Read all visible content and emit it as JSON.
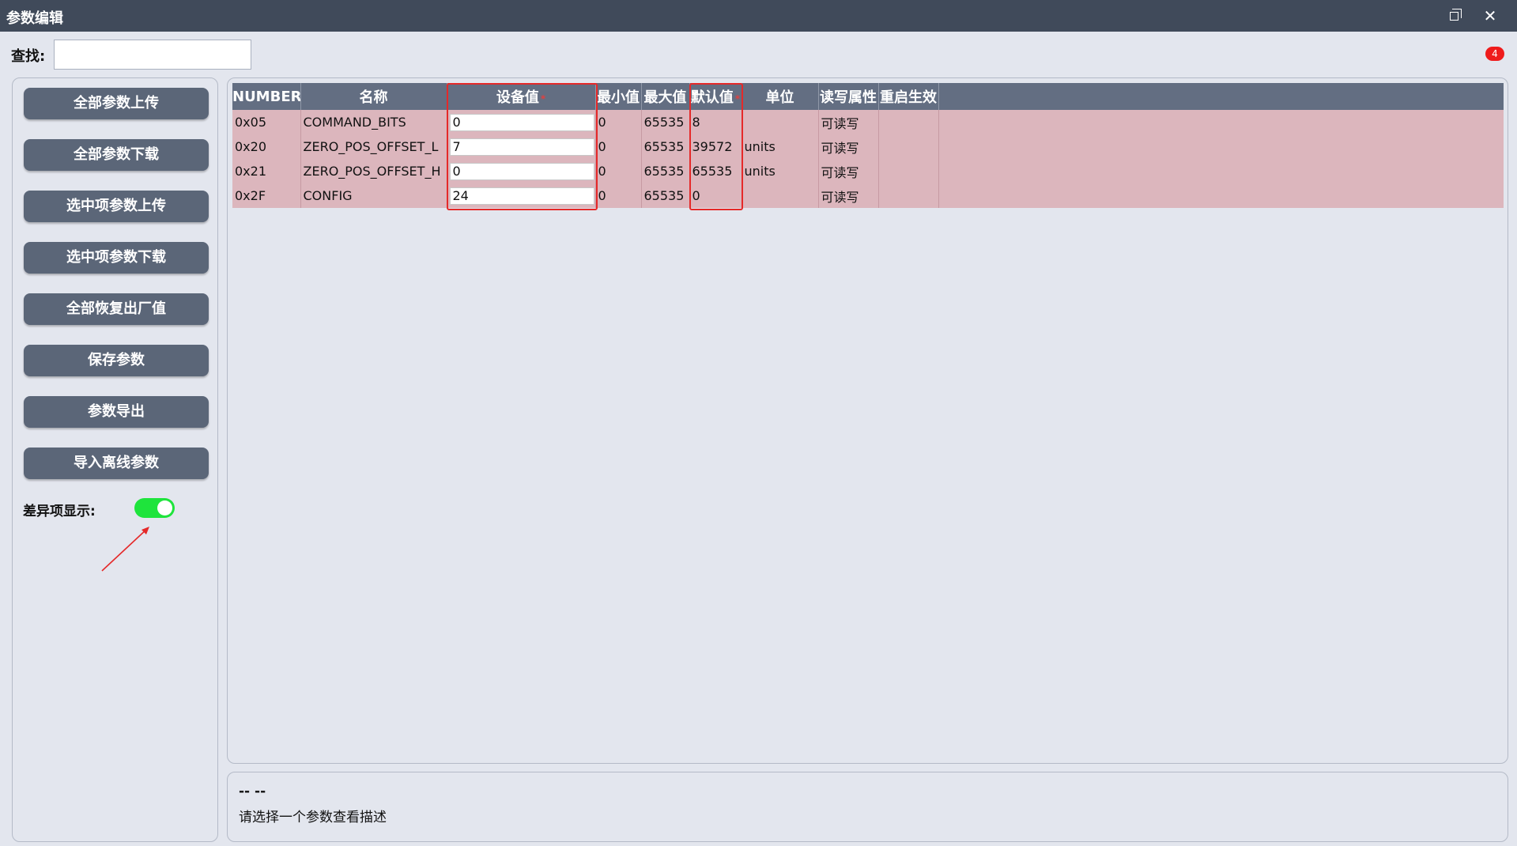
{
  "window": {
    "title": "参数编辑"
  },
  "search": {
    "label": "查找:",
    "value": "",
    "placeholder": ""
  },
  "badge": {
    "count": "4"
  },
  "sidebar": {
    "buttons": [
      {
        "label": "全部参数上传"
      },
      {
        "label": "全部参数下载"
      },
      {
        "label": "选中项参数上传"
      },
      {
        "label": "选中项参数下载"
      },
      {
        "label": "全部恢复出厂值"
      },
      {
        "label": "保存参数"
      },
      {
        "label": "参数导出"
      },
      {
        "label": "导入离线参数"
      }
    ],
    "diff_label": "差异项显示:",
    "diff_enabled": true
  },
  "table": {
    "columns": [
      "NUMBER",
      "名称",
      "设备值",
      "最小值",
      "最大值",
      "默认值",
      "单位",
      "读写属性",
      "重启生效"
    ],
    "required_marker": "*",
    "rows": [
      {
        "number": "0x05",
        "name": "COMMAND_BITS",
        "device_value": "0",
        "min": "0",
        "max": "65535",
        "default": "8",
        "unit": "",
        "rw": "可读写",
        "restart": ""
      },
      {
        "number": "0x20",
        "name": "ZERO_POS_OFFSET_L",
        "device_value": "7",
        "min": "0",
        "max": "65535",
        "default": "39572",
        "unit": "units",
        "rw": "可读写",
        "restart": ""
      },
      {
        "number": "0x21",
        "name": "ZERO_POS_OFFSET_H",
        "device_value": "0",
        "min": "0",
        "max": "65535",
        "default": "65535",
        "unit": "units",
        "rw": "可读写",
        "restart": ""
      },
      {
        "number": "0x2F",
        "name": "CONFIG",
        "device_value": "24",
        "min": "0",
        "max": "65535",
        "default": "0",
        "unit": "",
        "rw": "可读写",
        "restart": ""
      }
    ]
  },
  "description": {
    "title": "-- --",
    "text": "请选择一个参数查看描述"
  },
  "colors": {
    "titlebar": "#404a5a",
    "header": "#636e82",
    "row_highlight": "#dcb6bd",
    "button": "#5b6678",
    "toggle_on": "#1ee43c",
    "annotation": "#e52929"
  }
}
